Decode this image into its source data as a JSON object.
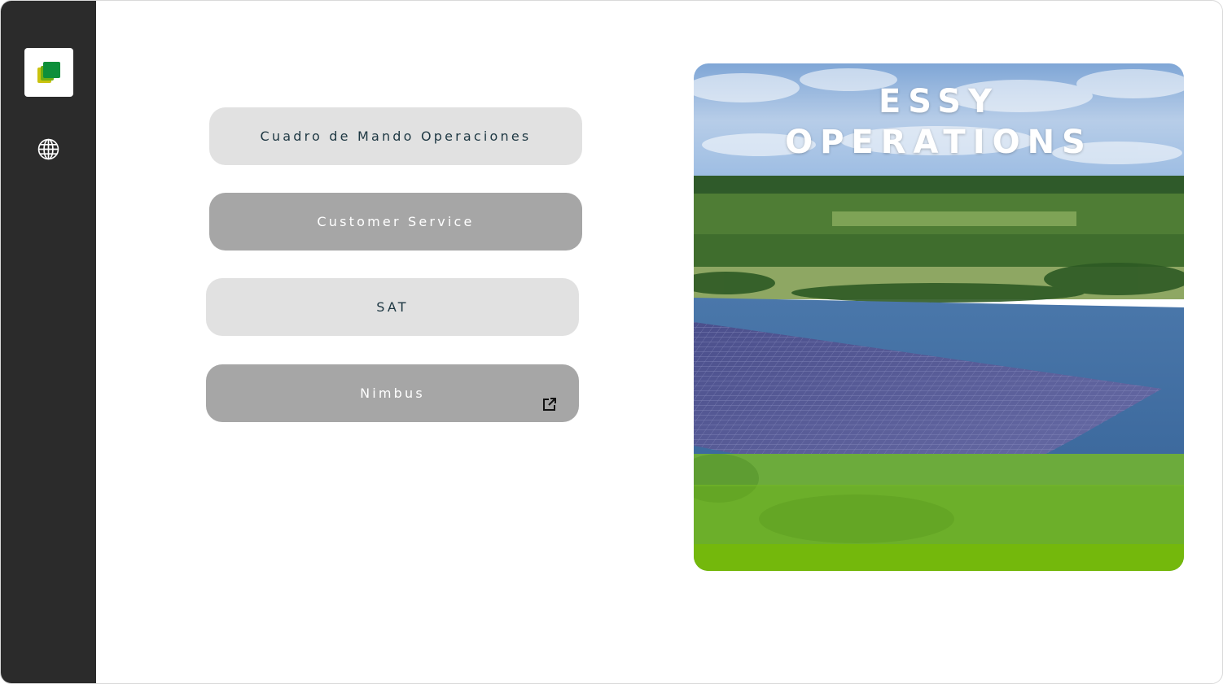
{
  "sidebar": {
    "logo_icon": "essy-logo-icon",
    "language_icon": "globe-icon"
  },
  "menu": {
    "buttons": [
      {
        "label": "Cuadro de Mando Operaciones",
        "style": "light"
      },
      {
        "label": "Customer Service",
        "style": "dark"
      },
      {
        "label": "SAT",
        "style": "light"
      },
      {
        "label": "Nimbus",
        "style": "dark",
        "icon": "external-link-icon"
      }
    ]
  },
  "hero": {
    "title_line1": "ESSY",
    "title_line2": "OPERATIONS",
    "image": "floating-solar-farm-lake-photo"
  },
  "colors": {
    "sidebar_bg": "#2b2b2b",
    "button_light": "#e1e1e1",
    "button_dark": "#a6a6a6",
    "brand_green": "#0d8f3a",
    "brand_lime": "#73b90b"
  }
}
